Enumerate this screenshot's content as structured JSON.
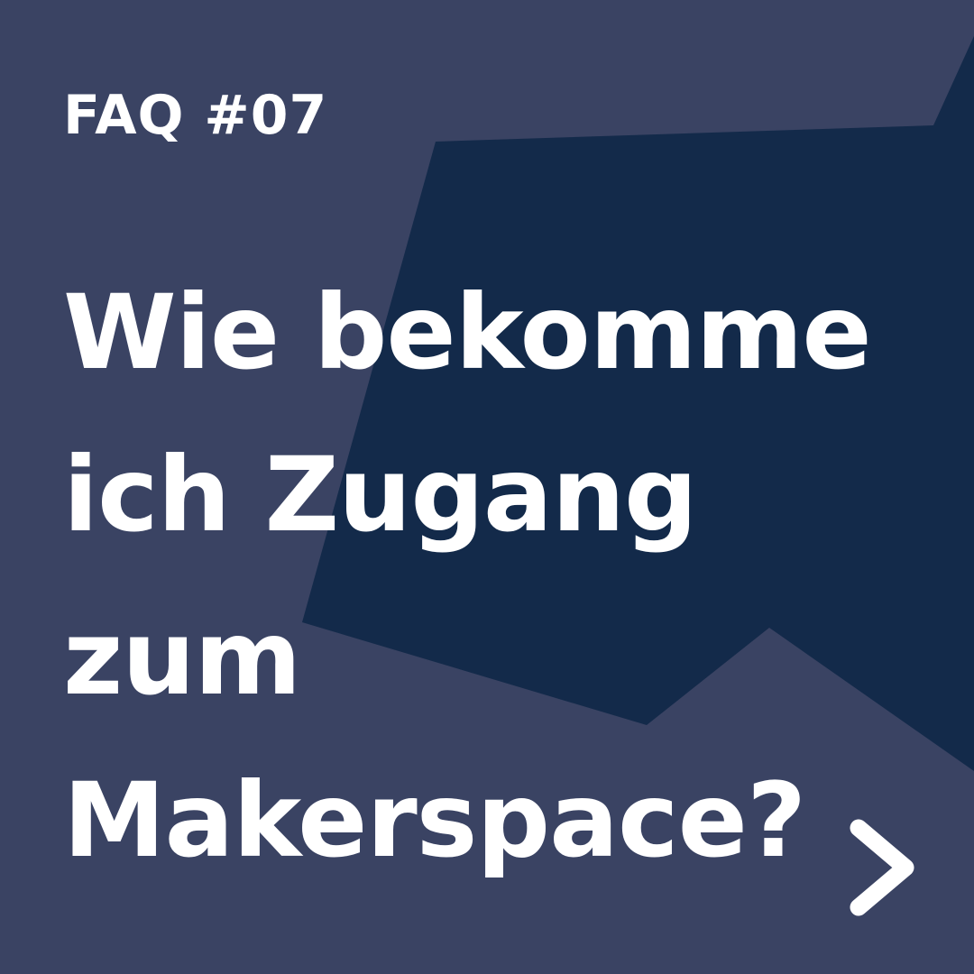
{
  "colors": {
    "background": "#3a4363",
    "shape": "#132a4a",
    "text": "#ffffff"
  },
  "label": "FAQ #07",
  "headline": {
    "line1": "Wie bekomme",
    "line2": "ich Zugang",
    "line3": "zum",
    "line4": "Makerspace?"
  },
  "next_icon": "chevron-right-icon"
}
